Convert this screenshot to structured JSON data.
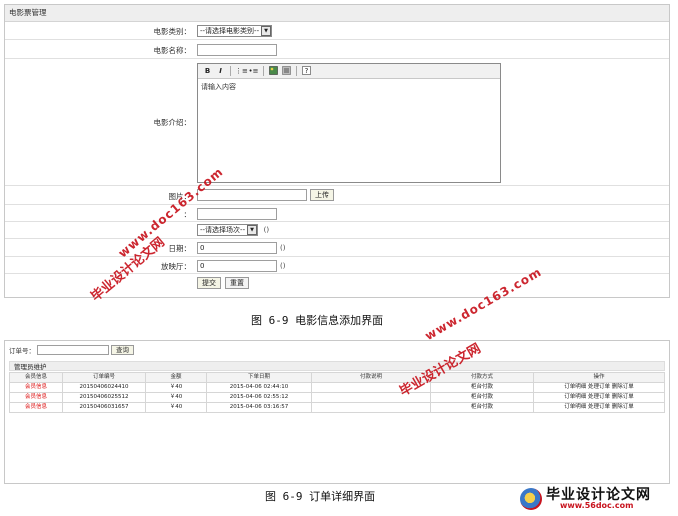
{
  "form_panel": {
    "title": "电影票管理",
    "labels": {
      "category": "电影类别：",
      "name": "电影名称：",
      "intro": "电影介绍：",
      "picture": "图片：",
      "row5": "：",
      "row7": "日期：",
      "hall": "放映厅："
    },
    "category_select": "--请选择电影类别--",
    "session_select": "--请选择场次--",
    "editor": {
      "toolbar": [
        "B",
        "I",
        "ordered-list-icon",
        "unordered-list-icon",
        "image-icon",
        "media-icon",
        "help-icon"
      ],
      "placeholder_text": "请输入内容"
    },
    "upload_label": "上传",
    "date_value": "0",
    "hall_value": "0",
    "paren_text": "()",
    "submit_label": "提交",
    "reset_label": "重置"
  },
  "caption1": "图 6-9 电影信息添加界面",
  "order_panel": {
    "search_label": "订单号：",
    "query_label": "查询",
    "section_title": "管理员维护",
    "columns": [
      "会员信息",
      "订单编号",
      "金额",
      "下单日期",
      "付款说明",
      "付款方式",
      "操作"
    ],
    "rows": [
      {
        "member": "会员信息",
        "order_no": "20150406024410",
        "amount": "￥40",
        "date": "2015-04-06 02:44:10",
        "note": "",
        "pay": "柜台付款",
        "ops": "订单明细 处理订单 删除订单"
      },
      {
        "member": "会员信息",
        "order_no": "20150406025512",
        "amount": "￥40",
        "date": "2015-04-06 02:55:12",
        "note": "",
        "pay": "柜台付款",
        "ops": "订单明细 处理订单 删除订单"
      },
      {
        "member": "会员信息",
        "order_no": "20150406031657",
        "amount": "￥40",
        "date": "2015-04-06 03:16:57",
        "note": "",
        "pay": "柜台付款",
        "ops": "订单明细 处理订单 删除订单"
      }
    ]
  },
  "caption2": "图 6-9 订单详细界面",
  "watermarks": {
    "cn": "毕业设计论文网",
    "url": "www.doc163.com"
  },
  "logo": {
    "cn": "毕业设计论文网",
    "url": "www.56doc.com"
  },
  "colors": {
    "watermark": "#c8141e",
    "link_red": "#dd1111",
    "header_bg": "#eeeeee"
  }
}
